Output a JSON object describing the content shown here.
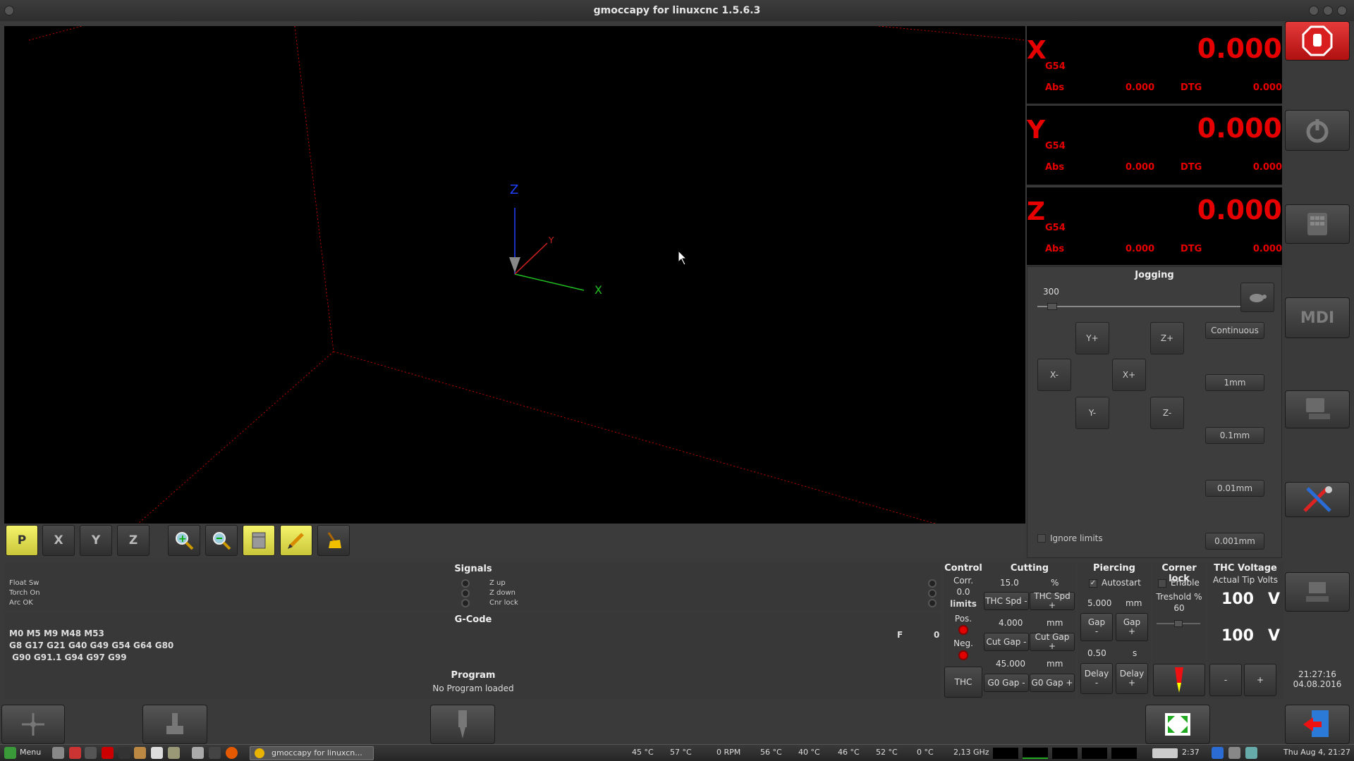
{
  "window": {
    "title": "gmoccapy for linuxcnc  1.5.6.3"
  },
  "preview": {
    "axis_labels": {
      "z": "Z",
      "x": "X",
      "y": "Y"
    }
  },
  "toolbar": {
    "buttons": [
      {
        "name": "view-p",
        "label": "P",
        "icon": "perspective-view-icon"
      },
      {
        "name": "view-x",
        "label": "X",
        "icon": "x-view-icon"
      },
      {
        "name": "view-y",
        "label": "Y",
        "icon": "y-view-icon"
      },
      {
        "name": "view-z",
        "label": "Z",
        "icon": "z-view-icon"
      },
      {
        "name": "zoom-in",
        "label": "",
        "icon": "zoom-in-icon"
      },
      {
        "name": "zoom-out",
        "label": "",
        "icon": "zoom-out-icon"
      },
      {
        "name": "show-dimensions",
        "label": "",
        "icon": "dimensions-icon"
      },
      {
        "name": "show-tool-path",
        "label": "",
        "icon": "pencil-icon"
      },
      {
        "name": "clear-plot",
        "label": "",
        "icon": "broom-icon"
      }
    ]
  },
  "dro": [
    {
      "axis": "X",
      "system": "G54",
      "value": "0.000",
      "abs_label": "Abs",
      "abs_value": "0.000",
      "dtg_label": "DTG",
      "dtg_value": "0.000"
    },
    {
      "axis": "Y",
      "system": "G54",
      "value": "0.000",
      "abs_label": "Abs",
      "abs_value": "0.000",
      "dtg_label": "DTG",
      "dtg_value": "0.000"
    },
    {
      "axis": "Z",
      "system": "G54",
      "value": "0.000",
      "abs_label": "Abs",
      "abs_value": "0.000",
      "dtg_label": "DTG",
      "dtg_value": "0.000"
    }
  ],
  "jogging": {
    "title": "Jogging",
    "speed": "300",
    "speed_slider_fraction": 0.05,
    "buttons": {
      "y_plus": "Y+",
      "z_plus": "Z+",
      "x_minus": "X-",
      "x_plus": "X+",
      "y_minus": "Y-",
      "z_minus": "Z-"
    },
    "increments": [
      "Continuous",
      "1mm",
      "0.1mm",
      "0.01mm",
      "0.001mm"
    ],
    "ignore_limits": "Ignore limits"
  },
  "signals": {
    "title": "Signals",
    "left": [
      "Float Sw",
      "Torch On",
      "Arc OK"
    ],
    "right": [
      "Z up",
      "Z down",
      "Cnr lock"
    ]
  },
  "gcode": {
    "title": "G-Code",
    "line1": "M0 M5 M9 M48 M53",
    "line2": "G8 G17 G21 G40 G49 G54 G64 G80",
    "line3": " G90 G91.1 G94 G97 G99",
    "f_label": "F",
    "f_value": "0"
  },
  "program": {
    "title": "Program",
    "status": "No Program loaded"
  },
  "control": {
    "title": "Control",
    "corr_label": "Corr.",
    "corr_value": "0.0",
    "limits": "limits",
    "pos": "Pos.",
    "neg": "Neg.",
    "thc_button": "THC"
  },
  "cutting": {
    "title": "Cutting",
    "spd_value": "15.0",
    "spd_unit": "%",
    "spd_minus": "THC Spd -",
    "spd_plus": "THC Spd +",
    "gap_value": "4.000",
    "gap_unit": "mm",
    "gap_minus": "Cut Gap -",
    "gap_plus": "Cut Gap +",
    "g0_value": "45.000",
    "g0_unit": "mm",
    "g0_minus": "G0 Gap -",
    "g0_plus": "G0 Gap +"
  },
  "piercing": {
    "title": "Piercing",
    "autostart": "Autostart",
    "gap_value": "5.000",
    "gap_unit": "mm",
    "gap_minus": "Gap\n-",
    "gap_plus": "Gap\n+",
    "delay_value": "0.50",
    "delay_unit": "s",
    "delay_minus": "Delay\n-",
    "delay_plus": "Delay\n+"
  },
  "corner_lock": {
    "title": "Corner lock",
    "enable": "Enable",
    "threshold_label": "Treshold %",
    "threshold_value": "60"
  },
  "thc_voltage": {
    "title": "THC Voltage",
    "actual_label": "Actual Tip Volts",
    "actual_value": "100",
    "actual_unit": "V",
    "set_value": "100",
    "set_unit": "V",
    "minus": "-",
    "plus": "+"
  },
  "clock": {
    "time": "21:27:16",
    "date": "04.08.2016"
  },
  "side_buttons": {
    "mdi_label": "MDI"
  },
  "taskbar": {
    "menu_label": "Menu",
    "task_label": "gmoccapy for linuxcn...",
    "temp1": "45 °C",
    "temp2": "57 °C",
    "rpm": "0 RPM",
    "temp3": "56 °C",
    "temp4": "40 °C",
    "temp5": "46 °C",
    "temp6": "52 °C",
    "temp7": "0 °C",
    "cpu": "2,13 GHz",
    "battery": "2:37",
    "datetime": "Thu Aug  4, 21:27"
  },
  "colors": {
    "dro_red": "#e60000",
    "background": "#3a3a3a",
    "preview_bg": "#000000",
    "estop_red": "#d81e1e"
  }
}
